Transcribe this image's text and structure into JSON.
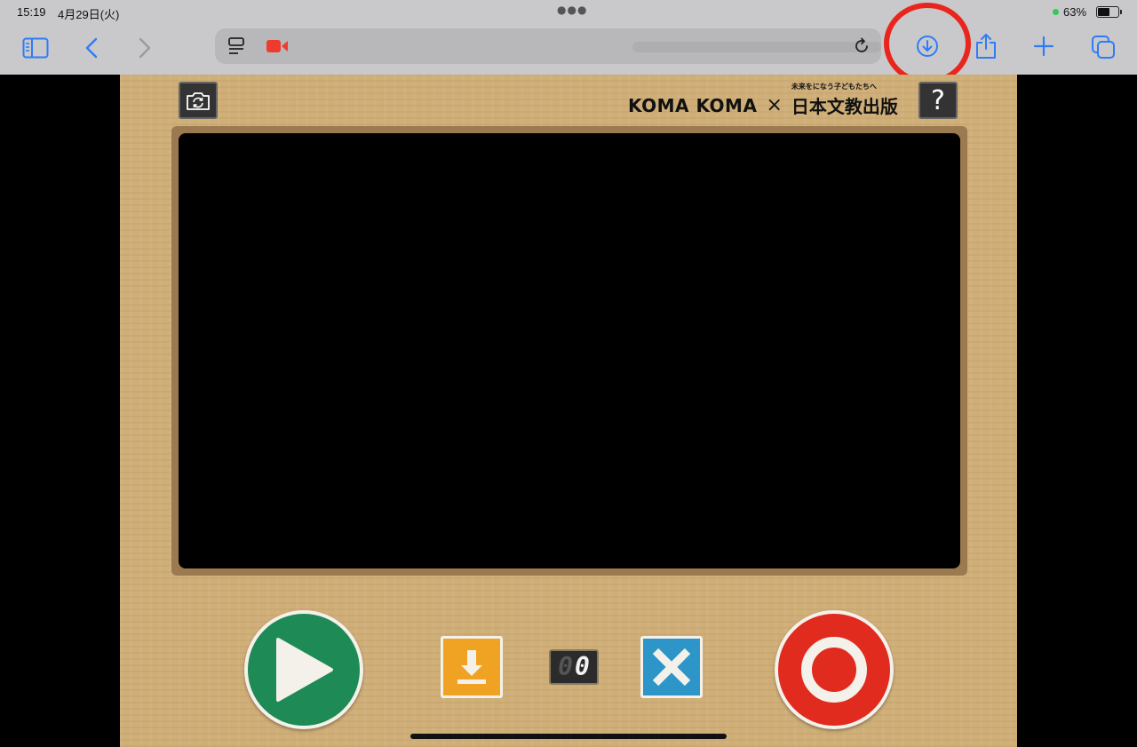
{
  "status_bar": {
    "time": "15:19",
    "date": "4月29日(火)",
    "battery_percent": "63%",
    "battery_level": 0.63
  },
  "browser": {
    "icons": {
      "sidebar": "sidebar-icon",
      "back": "back-chevron-icon",
      "forward": "forward-chevron-icon",
      "page_menu": "page-menu-icon",
      "recording": "camera-recording-icon",
      "reload": "reload-icon",
      "downloads": "downloads-icon",
      "share": "share-icon",
      "new_tab": "plus-icon",
      "tabs": "tabs-overview-icon"
    },
    "accent_color": "#2f7cf6",
    "highlight_color": "#e9261d"
  },
  "app": {
    "brand_koma": "KOMA KOMA",
    "brand_x": "×",
    "brand_publisher": "日本文教出版",
    "brand_tagline": "未来をになう子どもたちへ",
    "help_label": "?",
    "counter_digits": [
      "0",
      "0"
    ],
    "colors": {
      "play": "#1e8a55",
      "download": "#f0a323",
      "clear": "#2d95c7",
      "record": "#e02b1e"
    }
  }
}
